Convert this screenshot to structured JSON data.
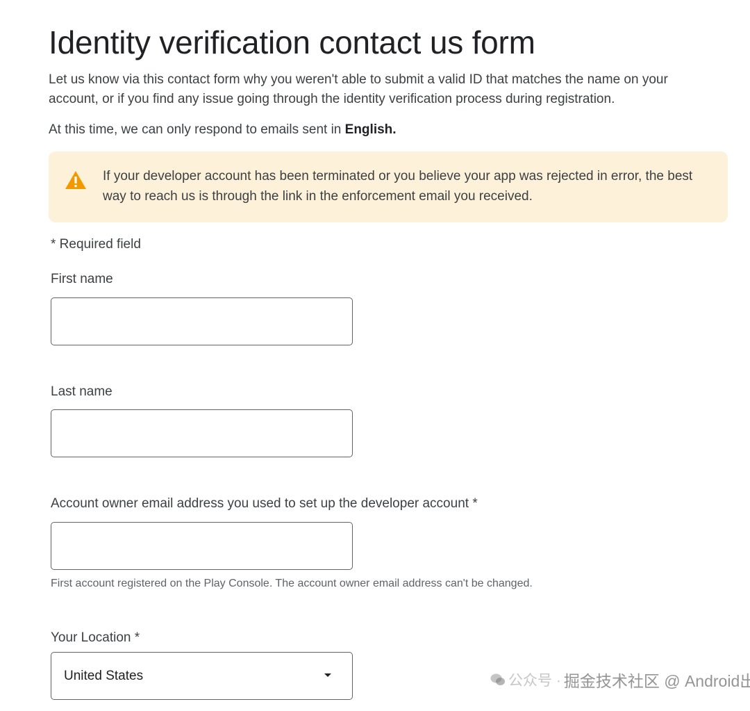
{
  "page": {
    "title": "Identity verification contact us form",
    "intro": "Let us know via this contact form why you weren't able to submit a valid ID that matches the name on your account, or if you find any issue going through the identity verification process during registration.",
    "language_note_prefix": "At this time, we can only respond to emails sent in ",
    "language_note_bold": "English."
  },
  "warning": {
    "icon": "warning-triangle-icon",
    "color": "#f29900",
    "background": "#fef1d9",
    "text": "If your developer account has been terminated or you believe your app was rejected in error, the best way to reach us is through the link in the enforcement email you received."
  },
  "form": {
    "required_note": "* Required field",
    "first_name": {
      "label": "First name",
      "value": "",
      "placeholder": ""
    },
    "last_name": {
      "label": "Last name",
      "value": "",
      "placeholder": ""
    },
    "email": {
      "label": "Account owner email address you used to set up the developer account *",
      "value": "",
      "placeholder": "",
      "helper": "First account registered on the Play Console. The account owner email address can't be changed."
    },
    "location": {
      "label": "Your Location *",
      "selected": "United States",
      "icon": "caret-down-icon"
    }
  },
  "watermark": {
    "icon": "wechat-icon",
    "prefix": "公众号 · ",
    "text": "掘金技术社区 @ Android出海"
  }
}
